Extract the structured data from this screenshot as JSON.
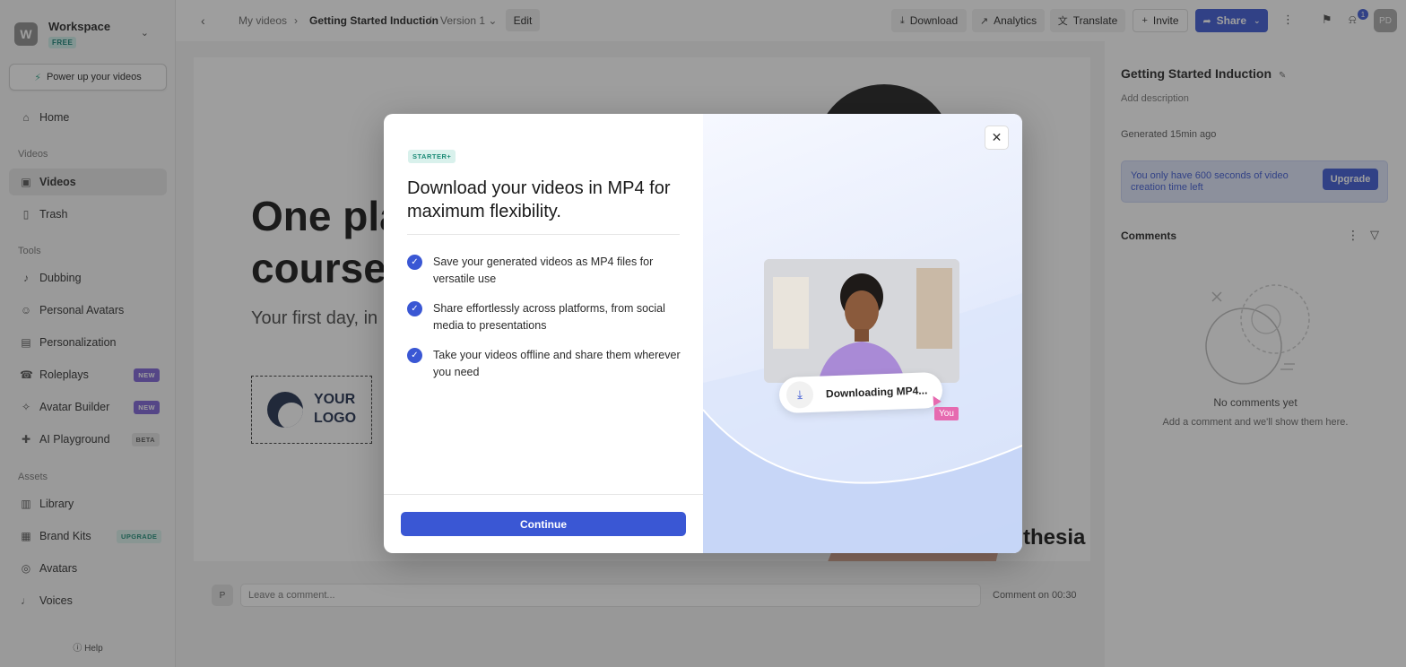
{
  "workspace": {
    "initial": "W",
    "name": "Workspace",
    "plan": "FREE"
  },
  "sidebar": {
    "power_label": "Power up your videos",
    "home": "Home",
    "section_videos": "Videos",
    "videos": "Videos",
    "trash": "Trash",
    "section_tools": "Tools",
    "tools": [
      {
        "label": "Dubbing",
        "badge": ""
      },
      {
        "label": "Personal Avatars",
        "badge": ""
      },
      {
        "label": "Personalization",
        "badge": ""
      },
      {
        "label": "Roleplays",
        "badge": "NEW"
      },
      {
        "label": "Avatar Builder",
        "badge": "NEW"
      },
      {
        "label": "AI Playground",
        "badge": "BETA"
      }
    ],
    "section_assets": "Assets",
    "assets": [
      {
        "label": "Library",
        "badge": ""
      },
      {
        "label": "Brand Kits",
        "badge": "UPGRADE"
      },
      {
        "label": "Avatars",
        "badge": ""
      },
      {
        "label": "Voices",
        "badge": ""
      }
    ],
    "help": "Help"
  },
  "topbar": {
    "crumb_my_videos": "My videos",
    "crumb_video": "Getting Started Induction",
    "crumb_sep": "/",
    "crumb_version": "Version 1",
    "edit": "Edit",
    "download": "Download",
    "analytics": "Analytics",
    "translate": "Translate",
    "invite": "Invite",
    "share": "Share",
    "notif_count": "1",
    "user_initials": "PD"
  },
  "preview": {
    "hero_line1": "One pla",
    "hero_line2": "course",
    "hero_sub": "Your first day, in",
    "logo_line1": "YOUR",
    "logo_line2": "LOGO",
    "brand_word": "thesia"
  },
  "comment_bar": {
    "avatar": "P",
    "placeholder": "Leave a comment...",
    "time": "Comment on 00:30"
  },
  "right_panel": {
    "title": "Getting Started Induction",
    "description_placeholder": "Add description",
    "generated": "Generated 15min ago",
    "alert_text": "You only have 600 seconds of video creation time left",
    "upgrade": "Upgrade",
    "comments_title": "Comments",
    "empty_title": "No comments yet",
    "empty_sub": "Add a comment and we'll show them here."
  },
  "modal": {
    "tag": "STARTER+",
    "title": "Download your videos in MP4 for maximum flexibility.",
    "features": [
      "Save your generated videos as MP4 files for versatile use",
      "Share effortlessly across platforms, from social media to presentations",
      "Take your videos offline and share them wherever you need"
    ],
    "continue": "Continue",
    "pill_text": "Downloading MP4...",
    "you_label": "You"
  },
  "colors": {
    "accent": "#3a57d4",
    "teal": "#1b8a76",
    "pink": "#e66ab0"
  }
}
